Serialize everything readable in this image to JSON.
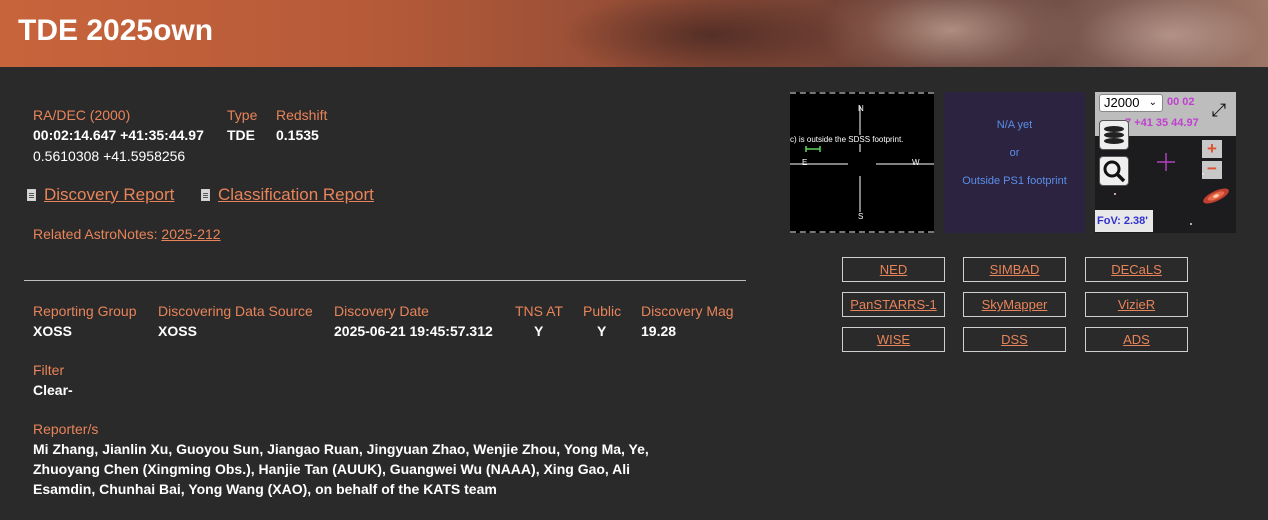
{
  "header": {
    "title": "TDE 2025own"
  },
  "coords": {
    "label": "RA/DEC (2000)",
    "sexagesimal": "00:02:14.647 +41:35:44.97",
    "decimal": "0.5610308 +41.5958256"
  },
  "type": {
    "label": "Type",
    "value": "TDE"
  },
  "redshift": {
    "label": "Redshift",
    "value": "0.1535"
  },
  "reports": {
    "discovery": "Discovery Report",
    "classification": "Classification Report"
  },
  "astronotes": {
    "label": "Related AstroNotes:",
    "link": "2025-212"
  },
  "discovery": {
    "headers": [
      "Reporting Group",
      "Discovering Data Source",
      "Discovery Date",
      "TNS AT",
      "Public",
      "Discovery Mag"
    ],
    "values": [
      "XOSS",
      "XOSS",
      "2025-06-21 19:45:57.312",
      "Y",
      "Y",
      "19.28"
    ]
  },
  "filter": {
    "label": "Filter",
    "value": "Clear-"
  },
  "reporters": {
    "label": "Reporter/s",
    "lines": [
      "Mi Zhang, Jianlin Xu, Guoyou Sun, Jiangao Ruan, Jingyuan Zhao, Wenjie Zhou, Yong Ma, Ye,",
      "Zhuoyang Chen (Xingming Obs.), Hanjie Tan (AUUK), Guangwei Wu (NAAA), Xing Gao, Ali",
      "Esamdin, Chunhai Bai, Yong Wang (XAO), on behalf of the KATS team"
    ]
  },
  "sdss": {
    "message": "c) is outside the SDSS footprint.",
    "n": "N",
    "s": "S",
    "e": "E",
    "w": "W"
  },
  "ps1": {
    "line1": "N/A yet",
    "line2": "or",
    "line3": "Outside PS1 footprint"
  },
  "aladin": {
    "frame_options": [
      "J2000"
    ],
    "frame_selected": "J2000",
    "coord_top": "00 02",
    "coord_bottom": "7 +41 35 44.97",
    "fov": "FoV: 2.38'"
  },
  "links": [
    "NED",
    "SIMBAD",
    "DECaLS",
    "PanSTARRS-1",
    "SkyMapper",
    "VizieR",
    "WISE",
    "DSS",
    "ADS"
  ],
  "colors": {
    "accent": "#e8845a",
    "background": "#2a2a2a",
    "aladin_text": "#c040d0"
  }
}
